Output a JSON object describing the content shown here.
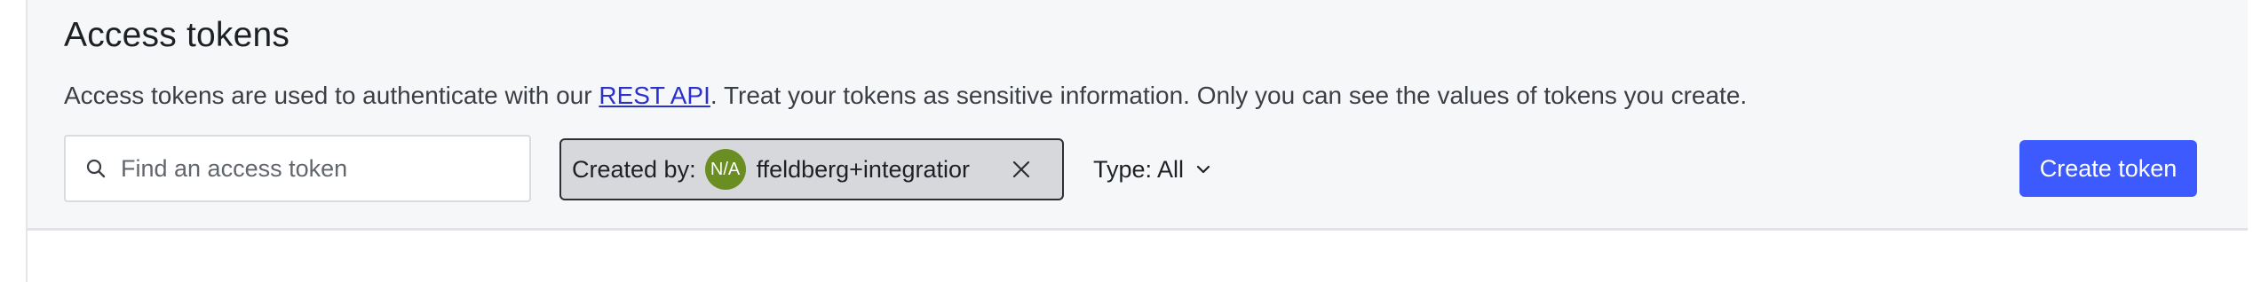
{
  "page": {
    "title": "Access tokens"
  },
  "description": {
    "before_link": "Access tokens are used to authenticate with our ",
    "link_text": "REST API",
    "after_link": ". Treat your tokens as sensitive information. Only you can see the values of tokens you create."
  },
  "search": {
    "placeholder": "Find an access token",
    "value": "",
    "icon": "search-icon"
  },
  "created_by_filter": {
    "label": "Created by:",
    "avatar_initials": "N/A",
    "avatar_color": "#6b8e23",
    "user": "ffeldberg+integratior",
    "remove_icon": "close-icon"
  },
  "type_filter": {
    "label": "Type: All",
    "icon": "chevron-down-icon"
  },
  "actions": {
    "create_label": "Create token",
    "create_color": "#3d5afe"
  }
}
